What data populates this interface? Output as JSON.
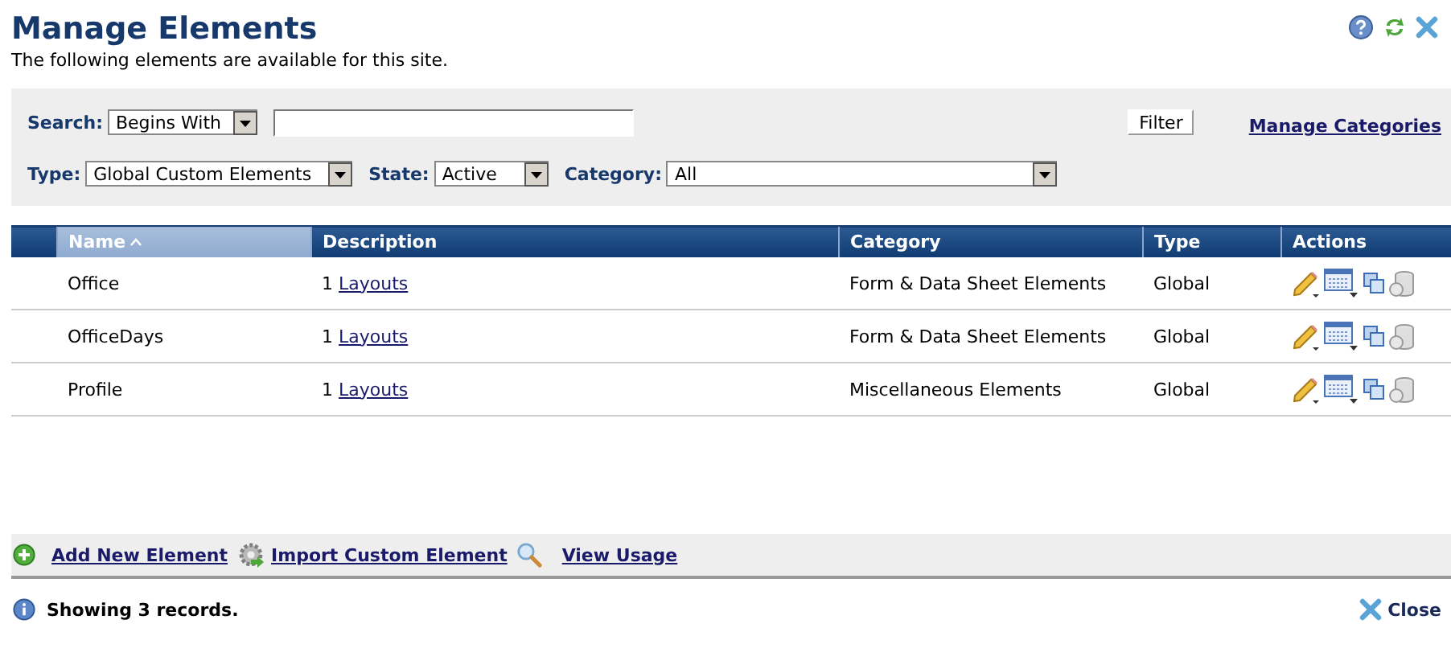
{
  "header": {
    "title": "Manage Elements",
    "subtitle": "The following elements are available for this site."
  },
  "filters": {
    "search": {
      "label": "Search:",
      "mode": "Begins With"
    },
    "filter_button": "Filter",
    "manage_link": "Manage Categories",
    "type": {
      "label": "Type:",
      "value": "Global Custom Elements"
    },
    "state": {
      "label": "State:",
      "value": "Active"
    },
    "category": {
      "label": "Category:",
      "value": "All"
    }
  },
  "table": {
    "columns": [
      {
        "label": "Name",
        "sorted": true
      },
      {
        "label": "Description",
        "sorted": false
      },
      {
        "label": "Category",
        "sorted": false
      },
      {
        "label": "Type",
        "sorted": false
      },
      {
        "label": "Actions",
        "sorted": false
      }
    ],
    "rows": [
      {
        "name": "Office",
        "count": "1",
        "link": "Layouts",
        "category": "Form & Data Sheet Elements",
        "type": "Global"
      },
      {
        "name": "OfficeDays",
        "count": "1",
        "link": "Layouts",
        "category": "Form & Data Sheet Elements",
        "type": "Global"
      },
      {
        "name": "Profile",
        "count": "1",
        "link": "Layouts",
        "category": "Miscellaneous Elements",
        "type": "Global"
      }
    ]
  },
  "toolbar": [
    {
      "kind": "add",
      "label": "Add New Element"
    },
    {
      "kind": "import",
      "label": "Import Custom Element"
    },
    {
      "kind": "usage",
      "label": "View Usage"
    }
  ],
  "status": {
    "text": "Showing 3 records.",
    "close": "Close"
  }
}
